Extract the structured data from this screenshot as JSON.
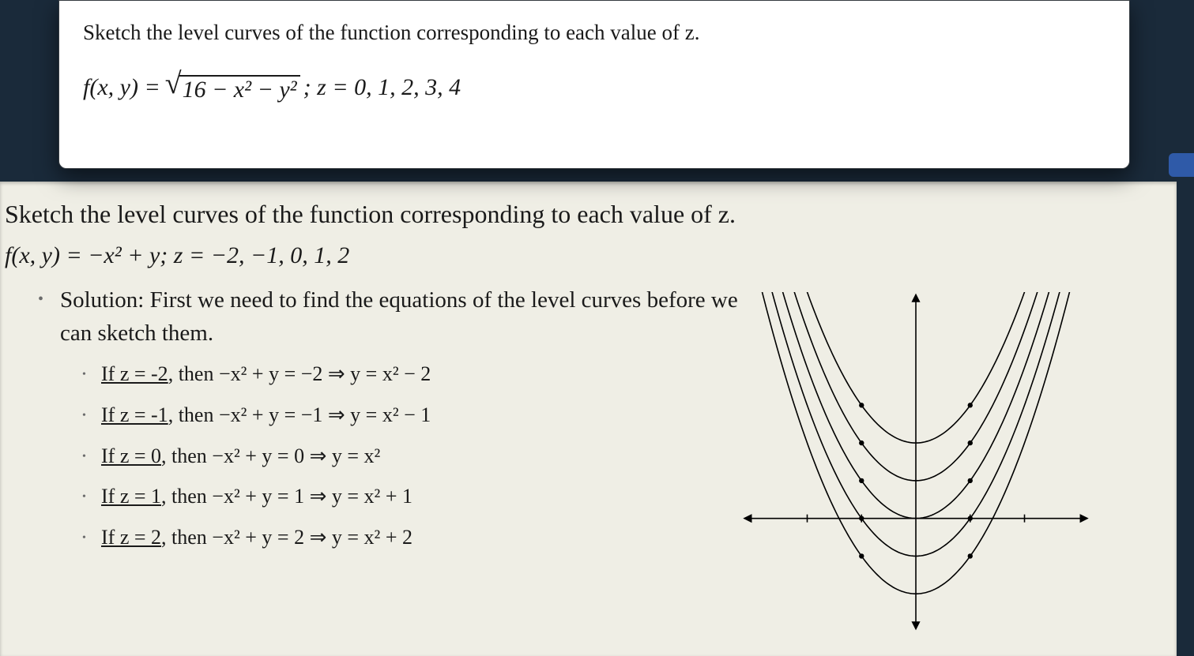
{
  "question": {
    "prompt": "Sketch the level curves of the function corresponding to each value of z.",
    "lhs": "f(x, y) = ",
    "radicand": "16 − x² − y²",
    "zlabel": ";   z =  0, 1, 2, 3, 4"
  },
  "slide": {
    "prompt": "Sketch the level curves of the function corresponding to each value of z.",
    "func": "f(x, y) = −x² + y;  z = −2, −1, 0, 1, 2",
    "solution_lead": "Solution:  First we need to find the equations of the level curves before we can sketch them.",
    "items": [
      {
        "pre": "If z = -2, then ",
        "eq": "−x² + y = −2 ⇒ y = x² − 2"
      },
      {
        "pre": "If z = -1, then ",
        "eq": "−x² + y = −1 ⇒ y = x² − 1"
      },
      {
        "pre": "If z = 0, then ",
        "eq": "−x² + y = 0 ⇒ y = x²"
      },
      {
        "pre": "If z = 1, then ",
        "eq": "−x² + y = 1 ⇒ y = x² + 1"
      },
      {
        "pre": "If z = 2, then ",
        "eq": "−x² + y = 2 ⇒ y = x² + 2"
      }
    ]
  },
  "diagram": {
    "x_range": [
      -3.2,
      3.2
    ],
    "y_range": [
      -3,
      6
    ],
    "parabola_shifts": [
      -2,
      -1,
      0,
      1,
      2
    ],
    "dots_x": [
      -1,
      1
    ]
  }
}
